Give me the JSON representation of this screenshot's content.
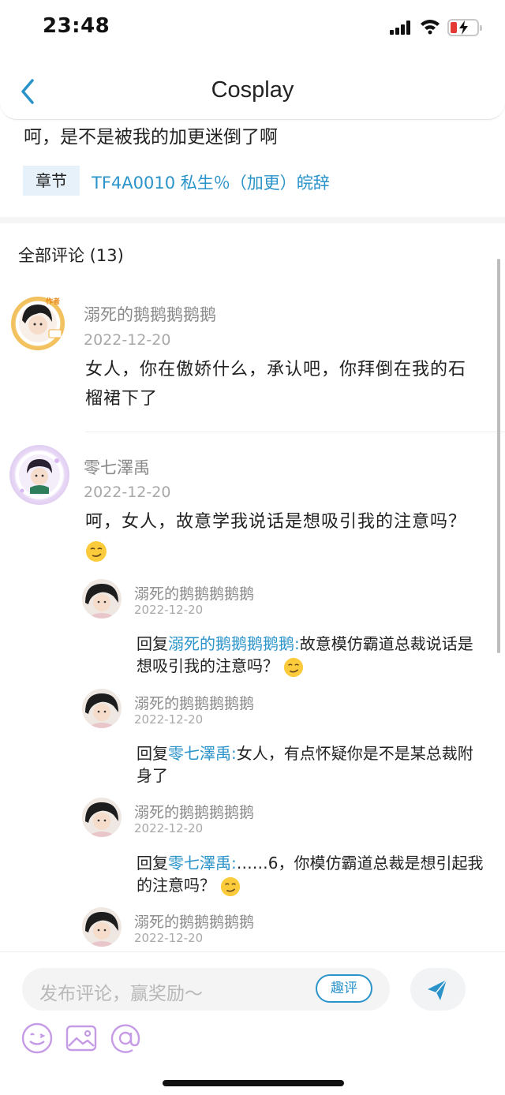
{
  "status_bar": {
    "time": "23:48"
  },
  "nav": {
    "title": "Cosplay",
    "back_icon": "chevron-left-icon"
  },
  "post": {
    "text": "呵，是不是被我的加更迷倒了啊",
    "chapter_label": "章节",
    "chapter_link": "TF4A0010 私生％（加更）皖辞"
  },
  "comments_title": "全部评论 (13)",
  "comments": [
    {
      "username": "溺死的鹅鹅鹅鹅鹅",
      "date": "2022-12-20",
      "badge": "作者",
      "text": "女人，你在傲娇什么，承认吧，你拜倒在我的石榴裙下了"
    },
    {
      "username": "零七澤禹",
      "date": "2022-12-20",
      "text": "呵，女人，故意学我说话是想吸引我的注意吗？",
      "emoji": "smirk-emoji",
      "replies": [
        {
          "username": "溺死的鹅鹅鹅鹅鹅",
          "date": "2022-12-20",
          "prefix": "回复",
          "target": "溺死的鹅鹅鹅鹅鹅:",
          "text": "故意模仿霸道总裁说话是想吸引我的注意吗？",
          "emoji": "smirk-emoji"
        },
        {
          "username": "溺死的鹅鹅鹅鹅鹅",
          "date": "2022-12-20",
          "prefix": "回复",
          "target": "零七澤禹:",
          "text": "女人，有点怀疑你是不是某总裁附身了"
        },
        {
          "username": "溺死的鹅鹅鹅鹅鹅",
          "date": "2022-12-20",
          "prefix": "回复",
          "target": "零七澤禹:",
          "text": "……6，你模仿霸道总裁是想引起我的注意吗？",
          "emoji": "smirk-emoji"
        },
        {
          "username": "溺死的鹅鹅鹅鹅鹅",
          "date": "2022-12-20"
        }
      ]
    }
  ],
  "input": {
    "placeholder": "发布评论，赢奖励～",
    "fun_button": "趣评"
  },
  "colors": {
    "accent": "#2a93c9",
    "icon_purple": "#c59be6"
  }
}
